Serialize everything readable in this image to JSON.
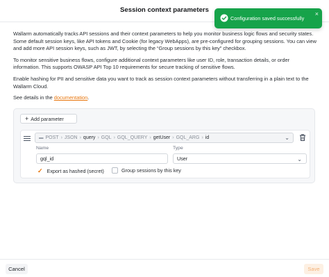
{
  "dialog": {
    "title": "Session context parameters",
    "close_icon": "close-icon"
  },
  "toast": {
    "message": "Configuration saved successfully",
    "icon": "check-circle-icon",
    "close": "×",
    "color": "#16a34a"
  },
  "intro": {
    "p1": "Wallarm automatically tracks API sessions and their context parameters to help you monitor business logic flows and security states. Some default session keys, like API tokens and Cookie (for legacy WebApps), are pre-configured for grouping sessions. You can view and add more API session keys, such as JWT, by selecting the “Group sessions by this key” checkbox.",
    "p2": "To monitor sensitive business flows, configure additional context parameters like user ID, role, transaction details, or order information. This supports OWASP API Top 10 requirements for secure tracking of sensitive flows.",
    "p3": "Enable hashing for PII and sensitive data you want to track as session context parameters without transferring in a plain text to the Wallarm Cloud.",
    "p4_prefix": "See details in the ",
    "p4_link": "documentation",
    "p4_suffix": "."
  },
  "parameters": {
    "add_label": "Add parameter",
    "items": [
      {
        "path": {
          "tag": "▬",
          "segments": [
            "POST",
            "JSON",
            "query",
            "GQL",
            "GQL_QUERY",
            "getUser",
            "GQL_ARG",
            "id"
          ],
          "muted": [
            true,
            true,
            false,
            true,
            true,
            false,
            true,
            false
          ]
        },
        "name_label": "Name",
        "name_value": "gql_id",
        "type_label": "Type",
        "type_value": "User",
        "export_hashed_label": "Export as hashed (secret)",
        "export_hashed_checked": true,
        "group_sessions_label": "Group sessions by this key",
        "group_sessions_checked": false
      }
    ]
  },
  "footer": {
    "cancel_label": "Cancel",
    "save_label": "Save"
  },
  "colors": {
    "accent": "#e8750b",
    "success": "#16a34a"
  }
}
